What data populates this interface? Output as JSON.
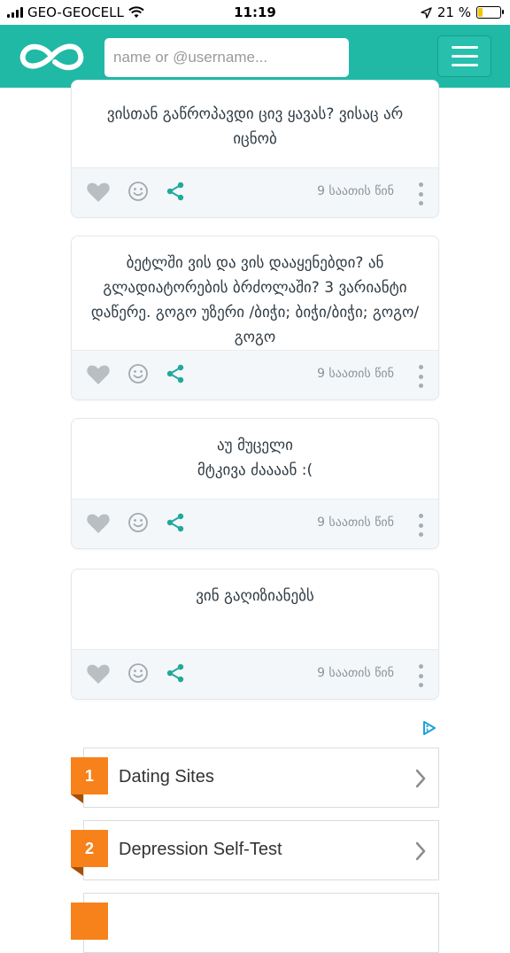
{
  "status_bar": {
    "carrier": "GEO-GEOCELL",
    "time": "11:19",
    "battery_percent": "21 %",
    "battery_level": 0.21
  },
  "header": {
    "search_placeholder": "name or @username...",
    "logo_icon": "infinity-logo-icon",
    "menu_icon": "hamburger-menu-icon"
  },
  "posts": [
    {
      "text": "ვისთან გაწროპავდი ცივ ყავას? ვისაც არ იცნობ",
      "time": "9 საათის წინ"
    },
    {
      "text": "ბეტლში ვის და ვის დააყენებდი? ან გლადიატორების ბრძოლაში? 3 ვარიანტი დაწერე. გოგო უზერი /ბიჭი; ბიჭი/ბიჭი; გოგო/გოგო",
      "time": "9 საათის წინ"
    },
    {
      "text": "აუ მუცელი\nმტკივა ძაააან :(",
      "time": "9 საათის წინ"
    },
    {
      "text": "ვინ გაღიზიანებს",
      "time": "9 საათის წინ"
    }
  ],
  "ads": [
    {
      "number": "1",
      "label": "Dating Sites"
    },
    {
      "number": "2",
      "label": "Depression Self-Test"
    }
  ],
  "colors": {
    "brand": "#20b9a6",
    "ad_badge": "#f7821b",
    "share_icon": "#20a99a"
  }
}
